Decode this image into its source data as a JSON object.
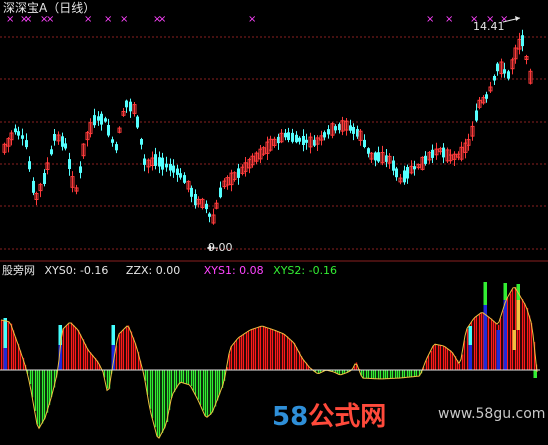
{
  "header": {
    "title": "深深宝A（日线）"
  },
  "price_panel": {
    "max_label": "14.41",
    "min_label": "9.00",
    "signal_marker": "×"
  },
  "indicator_panel": {
    "name": "股旁网",
    "xys0": "XYS0: -0.16",
    "zzx": "ZZX: 0.00",
    "xys1": "XYS1: 0.08",
    "xys2": "XYS2: -0.16"
  },
  "watermark": {
    "number": "58",
    "chinese": "公式网",
    "url": "www.58gu.com"
  },
  "colors": {
    "background": "#000000",
    "up": "#ff3b3b",
    "down": "#55ffff",
    "grid": "#8a1f1f",
    "signal": "#ff44ff",
    "indicator_pos": "#ff1a1a",
    "indicator_neg": "#33ee33",
    "indicator_blue": "#1d2bd9",
    "indicator_cyan": "#44ffff",
    "indicator_green": "#33ee33",
    "indicator_yellow": "#f0c040",
    "indicator_line": "#f0c040"
  }
}
